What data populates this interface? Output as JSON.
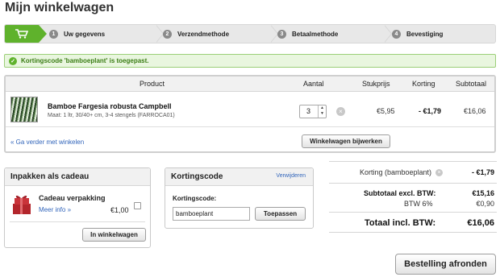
{
  "page": {
    "title": "Mijn winkelwagen"
  },
  "steps": [
    {
      "num": "1",
      "label": "Uw gegevens"
    },
    {
      "num": "2",
      "label": "Verzendmethode"
    },
    {
      "num": "3",
      "label": "Betaalmethode"
    },
    {
      "num": "4",
      "label": "Bevestiging"
    }
  ],
  "notice": {
    "text": "Kortingscode 'bamboeplant' is toegepast."
  },
  "table": {
    "headers": {
      "product": "Product",
      "quantity": "Aantal",
      "unit_price": "Stukprijs",
      "discount": "Korting",
      "subtotal": "Subtotaal"
    },
    "items": [
      {
        "name": "Bamboe Fargesia robusta Campbell",
        "description": "Maat: 1 ltr, 30/40+ cm, 3-4 stengels (FARROCA01)",
        "quantity": "3",
        "unit_price": "€5,95",
        "discount": "- €1,79",
        "subtotal": "€16,06"
      }
    ],
    "continue_link": "« Ga verder met winkelen",
    "update_button": "Winkelwagen bijwerken"
  },
  "gift": {
    "title": "Inpakken als cadeau",
    "name": "Cadeau verpakking",
    "more_link": "Meer info »",
    "price": "€1,00",
    "button": "In winkelwagen"
  },
  "coupon": {
    "title": "Kortingscode",
    "remove_link": "Verwijderen",
    "label": "Kortingscode:",
    "value": "bamboeplant",
    "button": "Toepassen"
  },
  "totals": {
    "discount_label": "Korting (bamboeplant)",
    "discount_value": "- €1,79",
    "subtotal_label": "Subtotaal excl. BTW:",
    "subtotal_value": "€15,16",
    "vat_label": "BTW 6%",
    "vat_value": "€0,90",
    "total_label": "Totaal incl. BTW:",
    "total_value": "€16,06"
  },
  "checkout": {
    "button": "Bestelling afronden"
  },
  "colors": {
    "accent": "#5fb22c",
    "link": "#3366bb",
    "notice_text": "#3a7d14"
  },
  "icons": [
    "cart-icon",
    "check-icon",
    "remove-icon",
    "gift-icon"
  ]
}
